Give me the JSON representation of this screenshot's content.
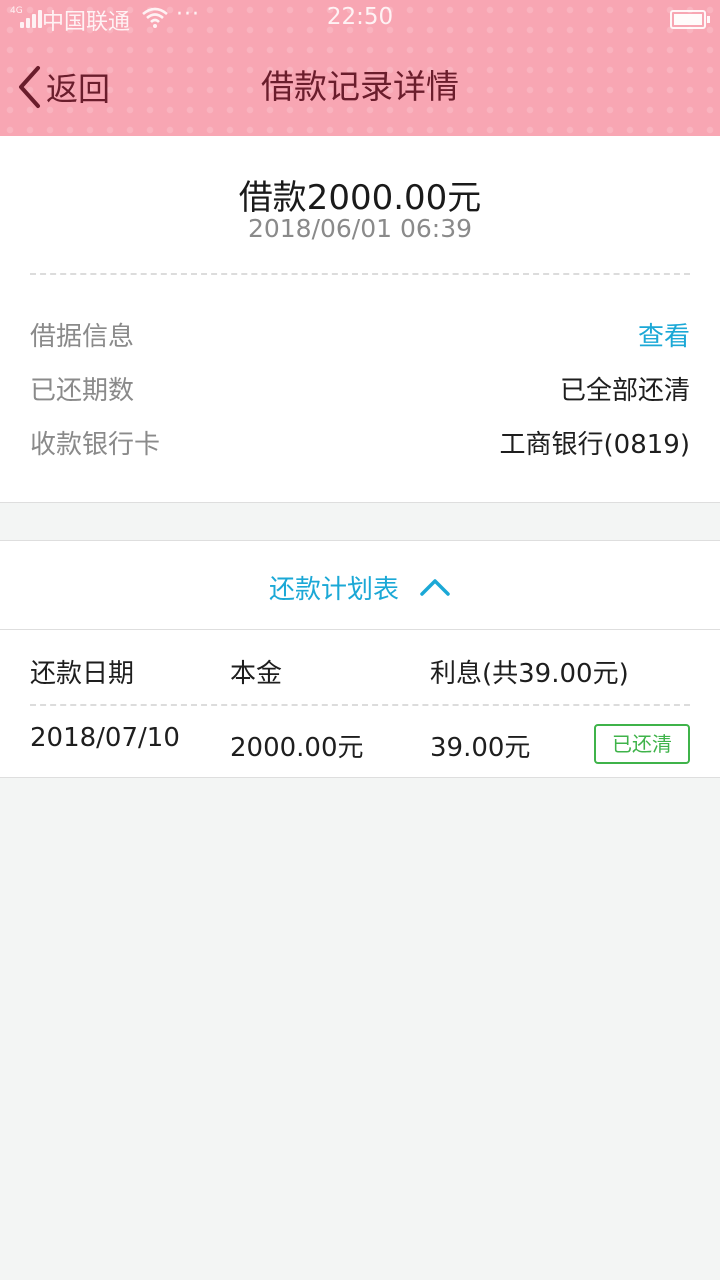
{
  "status_bar": {
    "network_tag": "4G",
    "carrier": "中国联通",
    "more": "···",
    "time": "22:50"
  },
  "header": {
    "back_label": "返回",
    "title": "借款记录详情"
  },
  "summary": {
    "amount": "借款2000.00元",
    "datetime": "2018/06/01 06:39"
  },
  "info": {
    "loan_note_label": "借据信息",
    "loan_note_action": "查看",
    "periods_label": "已还期数",
    "periods_value": "已全部还清",
    "card_label": "收款银行卡",
    "card_value": "工商银行(0819)"
  },
  "plan": {
    "toggle_label": "还款计划表",
    "columns": [
      "还款日期",
      "本金",
      "利息(共39.00元)"
    ],
    "rows": [
      {
        "date": "2018/07/10",
        "principal": "2000.00元",
        "interest": "39.00元",
        "status": "已还清"
      }
    ]
  },
  "colors": {
    "header_bg": "#f8a6b3",
    "header_text": "#6a1d2c",
    "link": "#1ba8d6",
    "paid_badge": "#3fb34a"
  }
}
